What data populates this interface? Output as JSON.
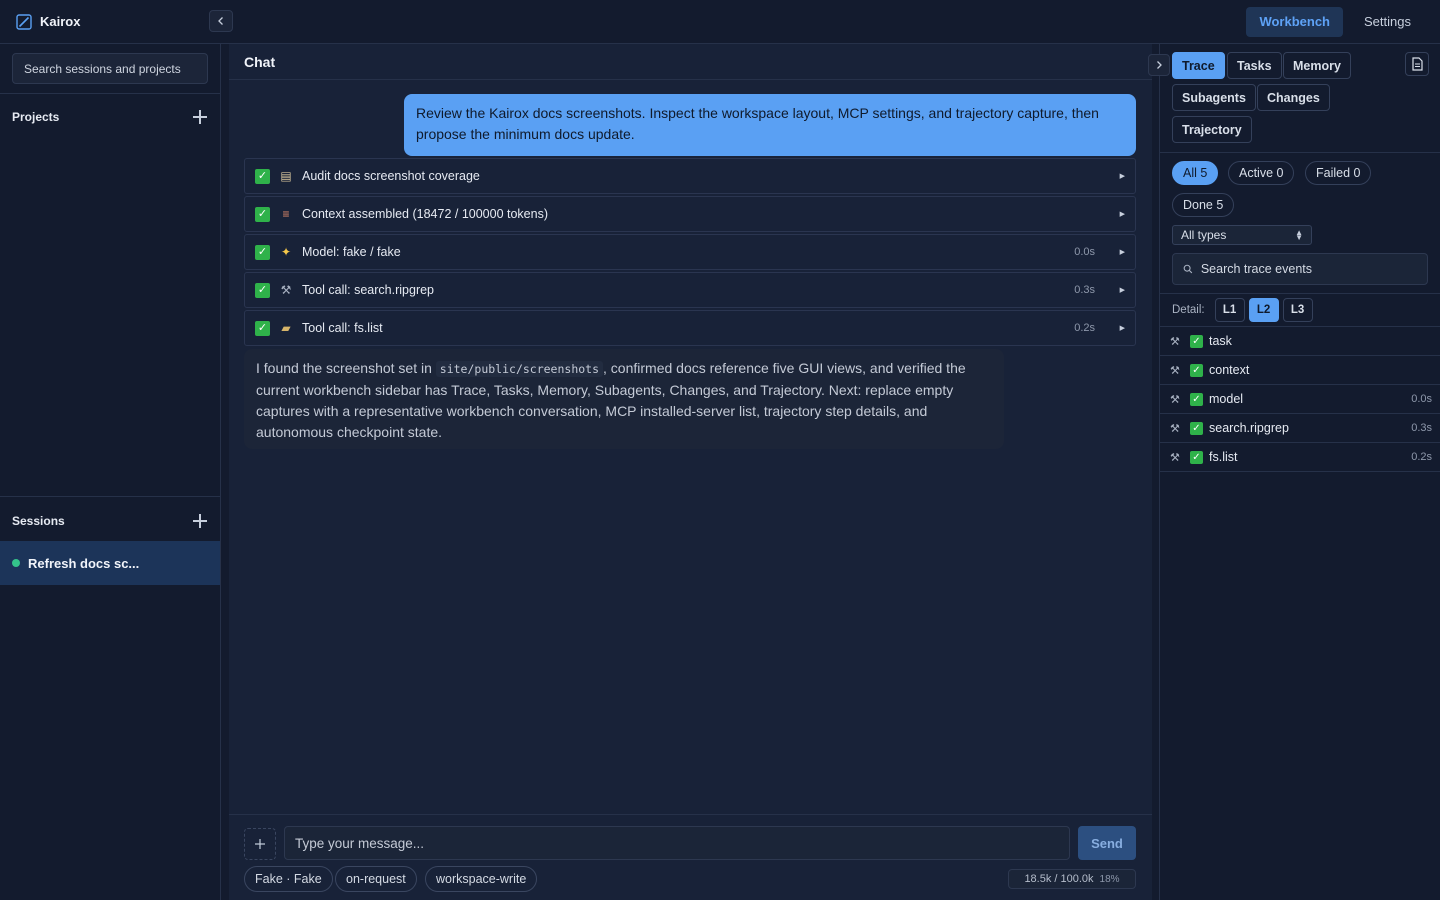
{
  "app": {
    "name": "Kairox",
    "nav": [
      {
        "label": "Workbench",
        "active": true
      },
      {
        "label": "Settings",
        "active": false
      }
    ]
  },
  "sidebar": {
    "search_placeholder": "Search sessions and projects",
    "projects_label": "Projects",
    "sessions_label": "Sessions",
    "sessions": [
      {
        "title": "Refresh docs sc...",
        "status_color": "#34c48b",
        "active": true
      }
    ]
  },
  "chat": {
    "title": "Chat",
    "user_message": "Review the Kairox docs screenshots. Inspect the workspace layout, MCP settings, and trajectory capture, then propose the minimum docs update.",
    "steps": [
      {
        "icon": "clipboard-icon",
        "label": "Audit docs screenshot coverage",
        "duration": ""
      },
      {
        "icon": "books-icon",
        "label": "Context assembled (18472 / 100000 tokens)",
        "duration": ""
      },
      {
        "icon": "sparkles-icon",
        "label": "Model: fake / fake",
        "duration": "0.0s"
      },
      {
        "icon": "wrench-icon",
        "label": "Tool call: search.ripgrep",
        "duration": "0.3s"
      },
      {
        "icon": "folder-icon",
        "label": "Tool call: fs.list",
        "duration": "0.2s"
      }
    ],
    "assistant_message": {
      "before": "I found the screenshot set in ",
      "code": "site/public/screenshots",
      "after": ", confirmed docs reference five GUI views, and verified the current workbench sidebar has Trace, Tasks, Memory, Subagents, Changes, and Trajectory. Next: replace empty captures with a representative workbench conversation, MCP installed-server list, trajectory step details, and autonomous checkpoint state."
    },
    "composer": {
      "placeholder": "Type your message...",
      "send_label": "Send",
      "chips": [
        "Fake · Fake",
        "on-request",
        "workspace-write"
      ],
      "token_usage": "18.5k / 100.0k",
      "token_percent": "18%"
    }
  },
  "panel": {
    "tabs": [
      {
        "label": "Trace",
        "active": true
      },
      {
        "label": "Tasks",
        "active": false
      },
      {
        "label": "Memory",
        "active": false
      },
      {
        "label": "Subagents",
        "active": false
      },
      {
        "label": "Changes",
        "active": false
      },
      {
        "label": "Trajectory",
        "active": false
      }
    ],
    "filters": [
      {
        "label": "All 5",
        "active": true
      },
      {
        "label": "Active 0",
        "active": false
      },
      {
        "label": "Failed 0",
        "active": false
      },
      {
        "label": "Done 5",
        "active": false
      }
    ],
    "type_select": "All types",
    "trace_search_placeholder": "Search trace events",
    "detail_label": "Detail:",
    "detail_levels": [
      {
        "label": "L1",
        "active": false
      },
      {
        "label": "L2",
        "active": true
      },
      {
        "label": "L3",
        "active": false
      }
    ],
    "events": [
      {
        "name": "task",
        "duration": ""
      },
      {
        "name": "context",
        "duration": ""
      },
      {
        "name": "model",
        "duration": "0.0s"
      },
      {
        "name": "search.ripgrep",
        "duration": "0.3s"
      },
      {
        "name": "fs.list",
        "duration": "0.2s"
      }
    ]
  },
  "colors": {
    "accent": "#5aa0f3",
    "success": "#2fb24a",
    "session_active": "#1c3459",
    "background": "#131b2e"
  }
}
